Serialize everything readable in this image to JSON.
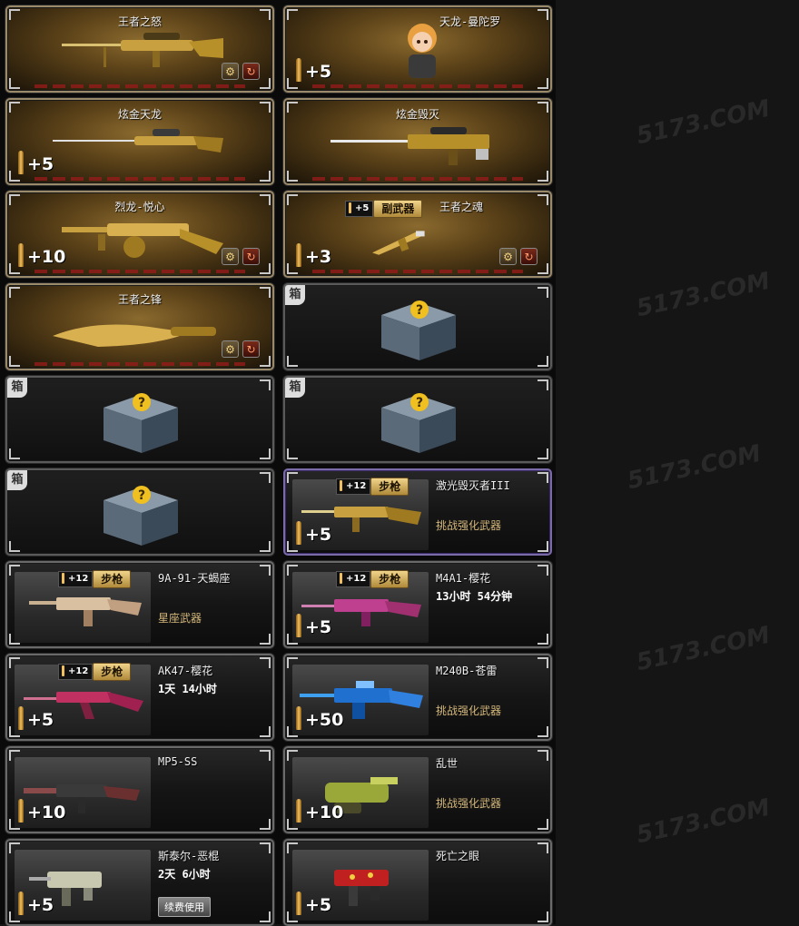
{
  "watermark_text": "5173.COM",
  "colors": {
    "gold_card": "#5d4319",
    "dark_card": "#151515",
    "accent_gold": "#f0c060",
    "red": "#9a1a1a"
  },
  "cards": [
    {
      "name": "王者之怒",
      "bonus": "",
      "weapon_icon": "sniper-rifle-icon"
    },
    {
      "name": "天龙-曼陀罗",
      "bonus": "+5",
      "weapon_icon": "character-avatar-icon"
    },
    {
      "name": "炫金天龙",
      "bonus": "+5",
      "weapon_icon": "sniper-rifle-icon"
    },
    {
      "name": "炫金毁灭",
      "bonus": "",
      "weapon_icon": "heavy-sniper-icon"
    },
    {
      "name": "烈龙-悦心",
      "bonus": "+10",
      "weapon_icon": "tommy-gun-icon"
    },
    {
      "name": "王者之魂",
      "bonus": "+3",
      "tag_plus": "+5",
      "tag_type": "副武器",
      "weapon_icon": "pistol-icon"
    },
    {
      "name": "王者之锋",
      "bonus": "",
      "weapon_icon": "knife-icon"
    },
    {
      "name": "",
      "badge": "箱",
      "weapon_icon": "mystery-box-icon"
    },
    {
      "name": "",
      "badge": "箱",
      "weapon_icon": "mystery-box-icon"
    },
    {
      "name": "",
      "badge": "箱",
      "weapon_icon": "mystery-box-icon"
    },
    {
      "name": "",
      "badge": "箱",
      "weapon_icon": "mystery-box-icon"
    },
    {
      "name": "激光毁灭者III",
      "bonus": "+5",
      "tag_plus": "+12",
      "tag_type": "步枪",
      "sub": "挑战强化武器",
      "weapon_icon": "assault-rifle-icon"
    },
    {
      "name": "9A-91-天蝎座",
      "bonus": "",
      "tag_plus": "+12",
      "tag_type": "步枪",
      "sub": "星座武器",
      "weapon_icon": "assault-rifle-icon"
    },
    {
      "name": "M4A1-樱花",
      "bonus": "+5",
      "tag_plus": "+12",
      "tag_type": "步枪",
      "time": "13小时 54分钟",
      "weapon_icon": "assault-rifle-icon"
    },
    {
      "name": "AK47-樱花",
      "bonus": "+5",
      "tag_plus": "+12",
      "tag_type": "步枪",
      "time": "1天 14小时",
      "weapon_icon": "assault-rifle-icon"
    },
    {
      "name": "M240B-苍雷",
      "bonus": "+50",
      "sub": "挑战强化武器",
      "weapon_icon": "machine-gun-icon"
    },
    {
      "name": "MP5-SS",
      "bonus": "+10",
      "weapon_icon": "smg-icon"
    },
    {
      "name": "乱世",
      "bonus": "+10",
      "sub": "挑战强化武器",
      "weapon_icon": "p90-icon"
    },
    {
      "name": "斯泰尔-恶棍",
      "bonus": "+5",
      "time": "2天 6小时",
      "button": "续费使用",
      "weapon_icon": "smg-icon"
    },
    {
      "name": "死亡之眼",
      "bonus": "+5",
      "weapon_icon": "smg-icon"
    }
  ]
}
